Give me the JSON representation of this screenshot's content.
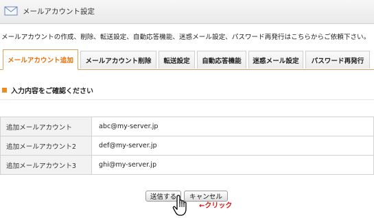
{
  "header": {
    "title": "メールアカウント設定",
    "icon": "mail-envelope-icon"
  },
  "intro": "メールアカウントの作成、削除、転送設定、自動応答機能、迷惑メール設定、パスワード再発行はこちらからご依頼下さい。",
  "tabs": [
    {
      "label": "メールアカウント追加",
      "active": true
    },
    {
      "label": "メールアカウント削除",
      "active": false
    },
    {
      "label": "転送設定",
      "active": false
    },
    {
      "label": "自動応答機能",
      "active": false
    },
    {
      "label": "迷惑メール設定",
      "active": false
    },
    {
      "label": "パスワード再発行",
      "active": false
    }
  ],
  "section": {
    "title": "入力内容をご確認ください"
  },
  "rows": [
    {
      "label": "追加メールアカウント",
      "value": "abc@my-server.jp"
    },
    {
      "label": "追加メールアカウント2",
      "value": "def@my-server.jp"
    },
    {
      "label": "追加メールアカウント3",
      "value": "ghi@my-server.jp"
    }
  ],
  "buttons": {
    "submit": "送信する",
    "cancel": "キャンセル"
  },
  "hint": "←クリック",
  "colors": {
    "accent": "#ee6b00",
    "hint": "#e01010",
    "bullet": "#f08a1c"
  }
}
